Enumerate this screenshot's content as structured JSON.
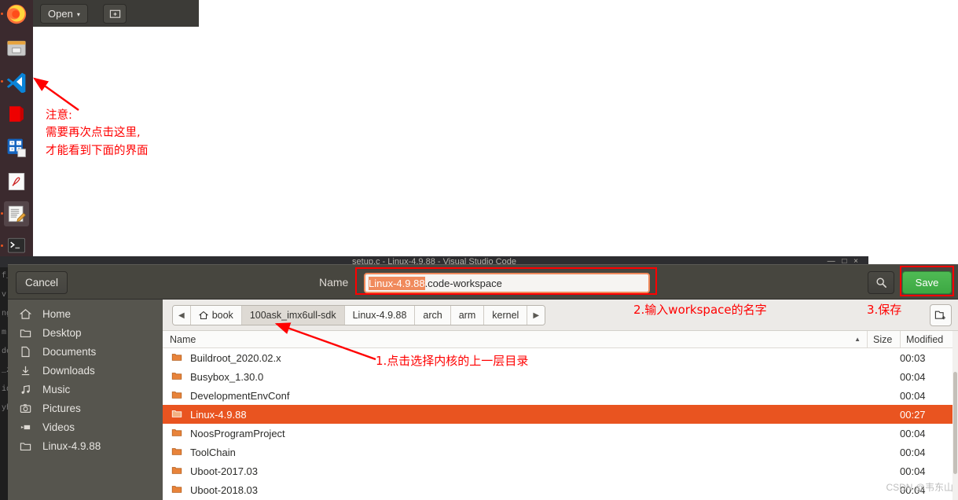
{
  "launcher": {
    "items": [
      {
        "name": "firefox-icon",
        "label": "Firefox",
        "running": true
      },
      {
        "name": "archive-manager-icon",
        "label": "Archive Manager",
        "running": false
      },
      {
        "name": "vscode-icon",
        "label": "Visual Studio Code",
        "running": true
      },
      {
        "name": "red-app-icon",
        "label": "Application",
        "running": false
      },
      {
        "name": "calculator-icon",
        "label": "Calculator",
        "running": false
      },
      {
        "name": "document-viewer-icon",
        "label": "Document Viewer",
        "running": false
      },
      {
        "name": "text-editor-icon",
        "label": "Text Editor",
        "running": true,
        "active": true
      },
      {
        "name": "terminal-icon",
        "label": "Terminal",
        "running": true
      }
    ]
  },
  "toolbar": {
    "open_label": "Open",
    "caret": "▾",
    "new_tab_label": ""
  },
  "note": {
    "text": "注意:\n需要再次点击这里,\n才能看到下面的界面"
  },
  "vscode": {
    "title": "setup.c - Linux-4.9.88 - Visual Studio Code",
    "window_buttons": "— □ ×",
    "code_fragments": "f_\nv\nng\nm\nde\n_z\nid\nyh"
  },
  "dialog": {
    "cancel_label": "Cancel",
    "save_label": "Save",
    "search_icon": "search-icon",
    "name_label": "Name",
    "filename_selected": "Linux-4.9.88",
    "filename_rest": ".code-workspace",
    "places": [
      {
        "icon": "home-icon",
        "label": "Home"
      },
      {
        "icon": "folder-icon",
        "label": "Desktop"
      },
      {
        "icon": "document-icon",
        "label": "Documents"
      },
      {
        "icon": "download-icon",
        "label": "Downloads"
      },
      {
        "icon": "music-icon",
        "label": "Music"
      },
      {
        "icon": "camera-icon",
        "label": "Pictures"
      },
      {
        "icon": "video-icon",
        "label": "Videos"
      },
      {
        "icon": "folder-icon",
        "label": "Linux-4.9.88"
      }
    ],
    "breadcrumbs": {
      "prev_label": "◀",
      "next_label": "▶",
      "items": [
        {
          "label": "book",
          "icon": "home-icon",
          "active": false
        },
        {
          "label": "100ask_imx6ull-sdk",
          "active": true
        },
        {
          "label": "Linux-4.9.88",
          "active": false
        },
        {
          "label": "arch",
          "active": false
        },
        {
          "label": "arm",
          "active": false
        },
        {
          "label": "kernel",
          "active": false
        }
      ]
    },
    "new_folder_icon": "new-folder-icon",
    "columns": {
      "name": "Name",
      "sort_arrow": "▲",
      "size": "Size",
      "modified": "Modified"
    },
    "files": [
      {
        "name": "Buildroot_2020.02.x",
        "size": "",
        "modified": "00:03",
        "selected": false
      },
      {
        "name": "Busybox_1.30.0",
        "size": "",
        "modified": "00:04",
        "selected": false
      },
      {
        "name": "DevelopmentEnvConf",
        "size": "",
        "modified": "00:04",
        "selected": false
      },
      {
        "name": "Linux-4.9.88",
        "size": "",
        "modified": "00:27",
        "selected": true
      },
      {
        "name": "NoosProgramProject",
        "size": "",
        "modified": "00:04",
        "selected": false
      },
      {
        "name": "ToolChain",
        "size": "",
        "modified": "00:04",
        "selected": false
      },
      {
        "name": "Uboot-2017.03",
        "size": "",
        "modified": "00:04",
        "selected": false
      },
      {
        "name": "Uboot-2018.03",
        "size": "",
        "modified": "00:04",
        "selected": false
      }
    ]
  },
  "annotations": {
    "step1": "1.点击选择内核的上一层目录",
    "step2": "2.输入workspace的名字",
    "step3": "3.保存"
  },
  "watermark": "CSDN @韦东山",
  "colors": {
    "accent_orange": "#e95420",
    "save_green": "#4fba54",
    "annotation_red": "#ff0000",
    "dialog_bg": "#3c3b37",
    "places_bg": "#56554e"
  }
}
